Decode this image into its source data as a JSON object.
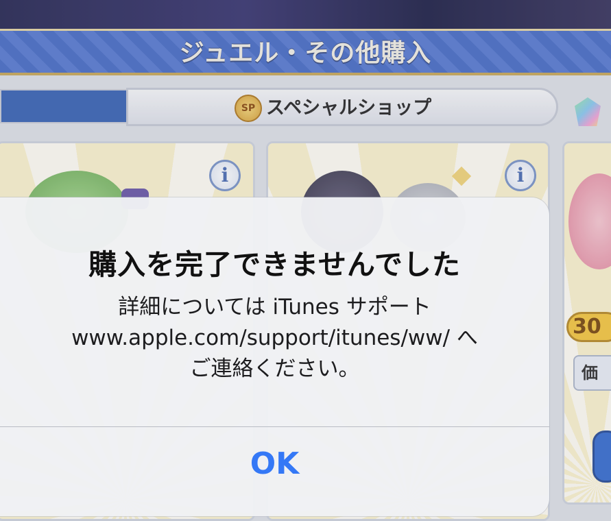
{
  "header": {
    "title": "ジュエル・その他購入"
  },
  "tabs": {
    "special_shop_label": "スペシャルショップ",
    "special_shop_badge": "SP"
  },
  "cards": {
    "info_glyph": "i",
    "card3_badge": "30",
    "card3_price_label": "価"
  },
  "alert": {
    "title": "購入を完了できませんでした",
    "message_line1": "詳細については iTunes サポート",
    "message_line2": "www.apple.com/support/itunes/ww/ へ",
    "message_line3": "ご連絡ください。",
    "ok_label": "OK"
  },
  "colors": {
    "title_bar": "#4b6fc6",
    "tab_active": "#3c66b5",
    "ios_link_blue": "#3478f6"
  }
}
